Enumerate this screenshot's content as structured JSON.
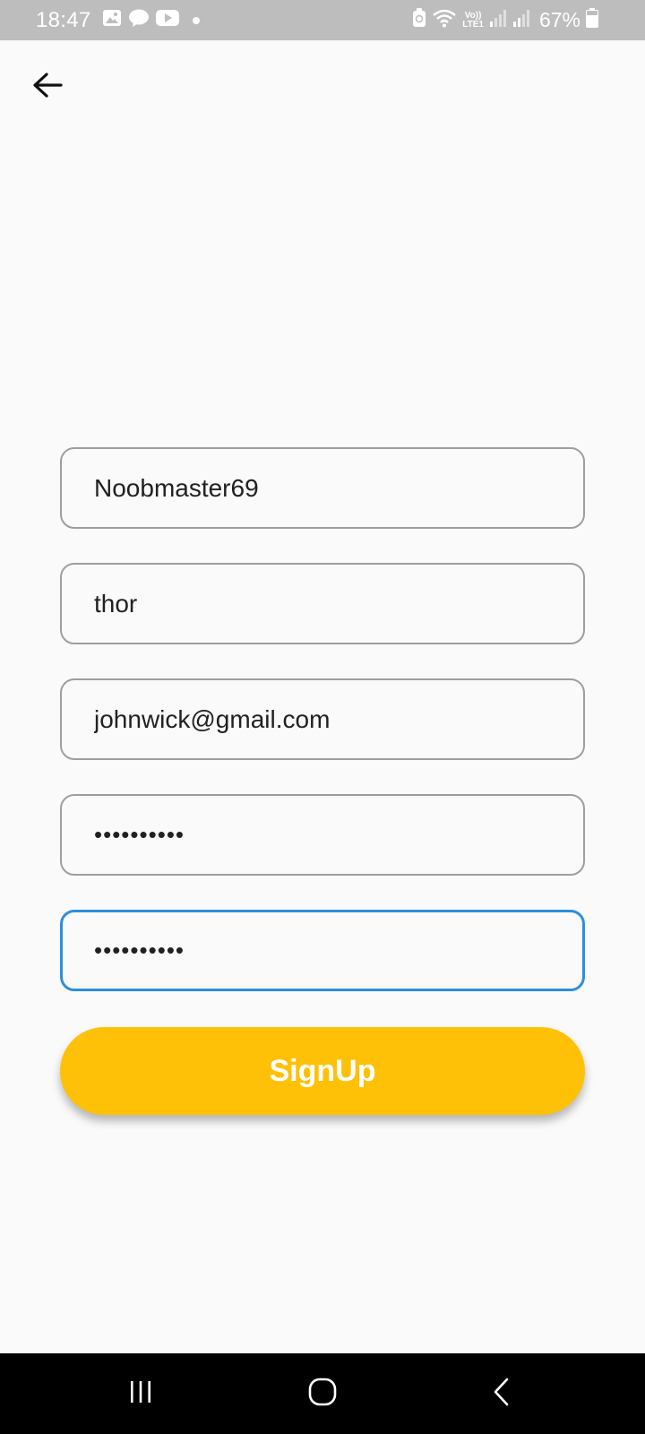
{
  "status_bar": {
    "time": "18:47",
    "lte_top": "Vo))",
    "lte_bottom": "LTE1",
    "battery_percent": "67%",
    "icons": [
      "gallery-icon",
      "chat-icon",
      "youtube-icon",
      "notification-dot-icon",
      "battery-saver-icon",
      "wifi-icon",
      "signal-icon",
      "signal-icon",
      "battery-icon"
    ]
  },
  "app_bar": {
    "back_icon": "arrow-left-icon"
  },
  "form": {
    "username_value": "Noobmaster69",
    "name_value": "thor",
    "email_value": "johnwick@gmail.com",
    "password_value": "••••••••••",
    "confirm_password_value": "••••••••••",
    "signup_label": "SignUp"
  },
  "colors": {
    "accent_button": "#ffc107",
    "focus_border": "#2c8fde",
    "field_border": "#9e9e9e",
    "background": "#fafafa"
  },
  "nav_bar": {
    "icons": [
      "recent-apps-icon",
      "home-icon",
      "back-icon"
    ]
  }
}
